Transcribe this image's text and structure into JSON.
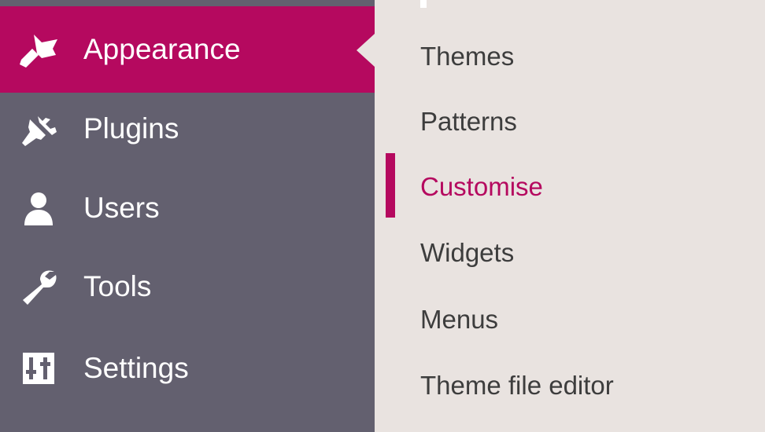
{
  "colors": {
    "sidebar_bg": "#63606f",
    "active_bg": "#b5095f",
    "submenu_bg": "#e9e3e0",
    "accent": "#b5095f",
    "submenu_text": "#3d3d3d"
  },
  "sidebar": {
    "items": [
      {
        "label": "Appearance",
        "icon": "paintbrush-icon",
        "active": true
      },
      {
        "label": "Plugins",
        "icon": "plug-icon",
        "active": false
      },
      {
        "label": "Users",
        "icon": "user-icon",
        "active": false
      },
      {
        "label": "Tools",
        "icon": "wrench-icon",
        "active": false
      },
      {
        "label": "Settings",
        "icon": "sliders-icon",
        "active": false
      }
    ]
  },
  "submenu": {
    "items": [
      {
        "label": "Themes",
        "current": false
      },
      {
        "label": "Patterns",
        "current": false
      },
      {
        "label": "Customise",
        "current": true
      },
      {
        "label": "Widgets",
        "current": false
      },
      {
        "label": "Menus",
        "current": false
      },
      {
        "label": "Theme file editor",
        "current": false
      }
    ]
  }
}
